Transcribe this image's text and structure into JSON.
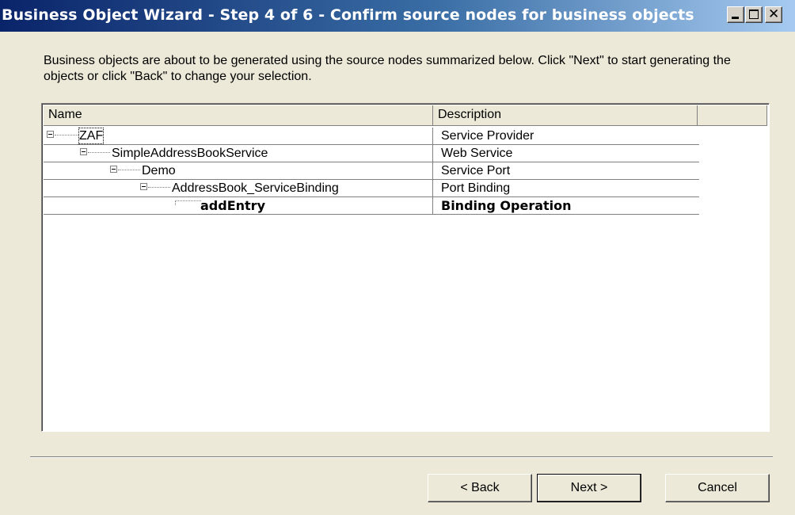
{
  "window": {
    "title": "Business Object Wizard - Step 4 of 6 - Confirm source nodes for business objects",
    "controls": [
      "minimize-icon",
      "maximize-icon",
      "close-icon"
    ]
  },
  "intro": {
    "text": "Business objects are about to be generated using the source nodes summarized below. Click \"Next\" to start generating the objects or click \"Back\" to change your selection."
  },
  "table": {
    "columns": [
      "Name",
      "Description"
    ],
    "rows": [
      {
        "name": "ZAF",
        "description": "Service Provider"
      },
      {
        "name": "SimpleAddressBookService",
        "description": "Web Service"
      },
      {
        "name": "Demo",
        "description": "Service Port"
      },
      {
        "name": "AddressBook_ServiceBinding",
        "description": "Port Binding"
      },
      {
        "name": "addEntry",
        "description": "Binding Operation"
      }
    ]
  },
  "buttons": {
    "back": "< Back",
    "next": "Next >",
    "cancel": "Cancel"
  }
}
